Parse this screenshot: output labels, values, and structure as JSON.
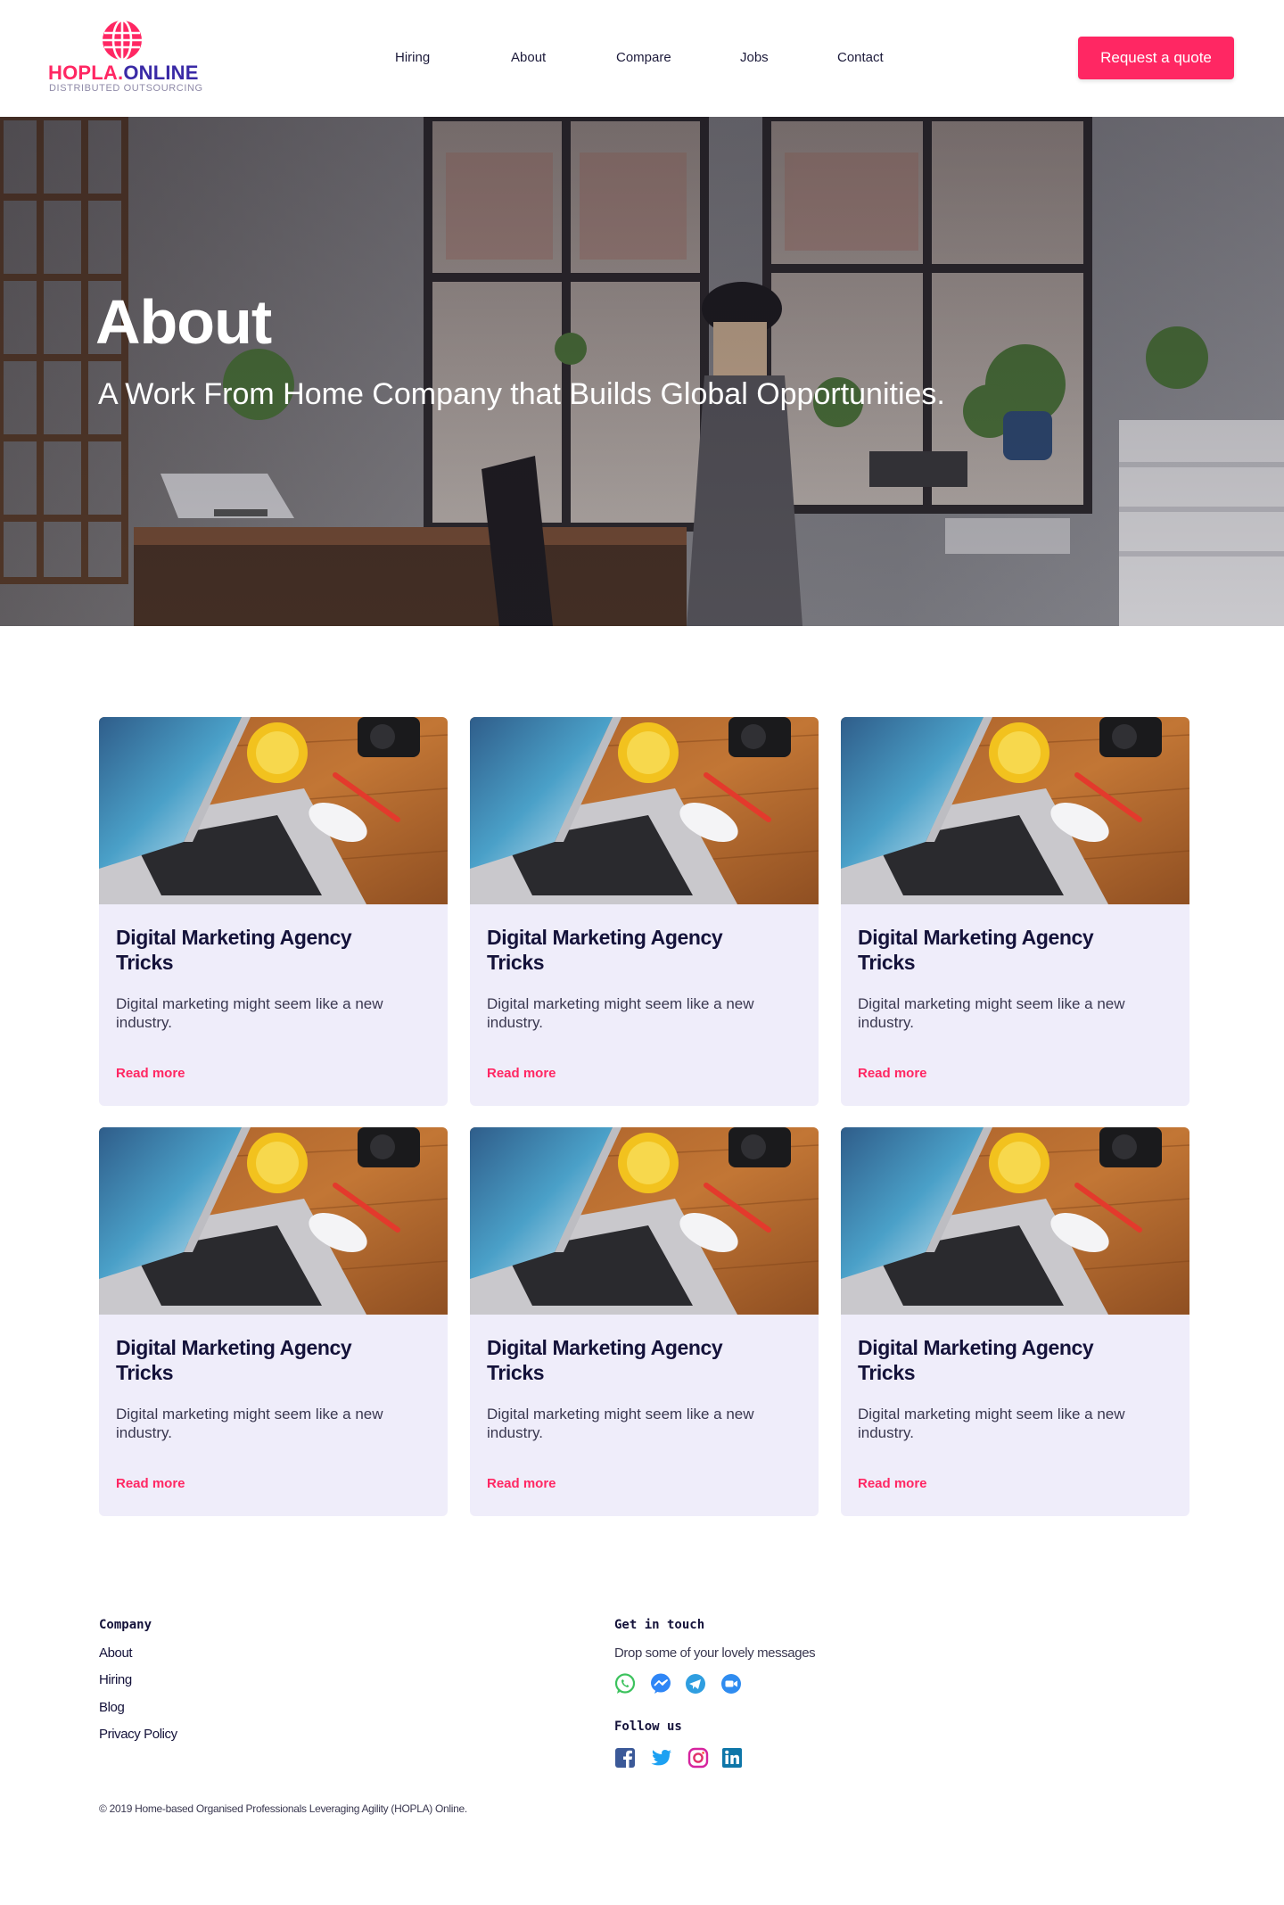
{
  "brand": {
    "name_part1": "HOPLA.",
    "name_part2": "ONLINE",
    "tagline": "DISTRIBUTED OUTSOURCING"
  },
  "nav": {
    "items": [
      {
        "label": "Hiring"
      },
      {
        "label": "About"
      },
      {
        "label": "Compare"
      },
      {
        "label": "Jobs"
      },
      {
        "label": "Contact"
      }
    ],
    "cta_label": "Request a quote"
  },
  "hero": {
    "title": "About",
    "subtitle": "A Work From Home Company that Builds Global Opportunities."
  },
  "posts": [
    {
      "title": "Digital Marketing Agency Tricks",
      "excerpt": "Digital marketing might seem like a new industry.",
      "link": "Read more"
    },
    {
      "title": "Digital Marketing Agency Tricks",
      "excerpt": "Digital marketing might seem like a new industry.",
      "link": "Read more"
    },
    {
      "title": "Digital Marketing Agency Tricks",
      "excerpt": "Digital marketing might seem like a new industry.",
      "link": "Read more"
    },
    {
      "title": "Digital Marketing Agency Tricks",
      "excerpt": "Digital marketing might seem like a new industry.",
      "link": "Read more"
    },
    {
      "title": "Digital Marketing Agency Tricks",
      "excerpt": "Digital marketing might seem like a new industry.",
      "link": "Read more"
    },
    {
      "title": "Digital Marketing Agency Tricks",
      "excerpt": "Digital marketing might seem like a new industry.",
      "link": "Read more"
    }
  ],
  "footer": {
    "company_heading": "Company",
    "company_links": [
      {
        "label": "About"
      },
      {
        "label": "Hiring"
      },
      {
        "label": "Blog"
      },
      {
        "label": "Privacy Policy"
      }
    ],
    "contact_heading": "Get in touch",
    "contact_text": "Drop some of your lovely messages",
    "contact_icons": [
      "whatsapp-icon",
      "messenger-icon",
      "telegram-icon",
      "zoom-icon"
    ],
    "follow_heading": "Follow us",
    "social_icons": [
      "facebook-icon",
      "twitter-icon",
      "instagram-icon",
      "linkedin-icon"
    ],
    "copyright": "© 2019 Home-based Organised Professionals Leveraging Agility (HOPLA) Online."
  },
  "colors": {
    "accent": "#ff2763",
    "brand_blue": "#3a2aa6",
    "card_bg": "#efedfa",
    "text_dark": "#14123a"
  }
}
